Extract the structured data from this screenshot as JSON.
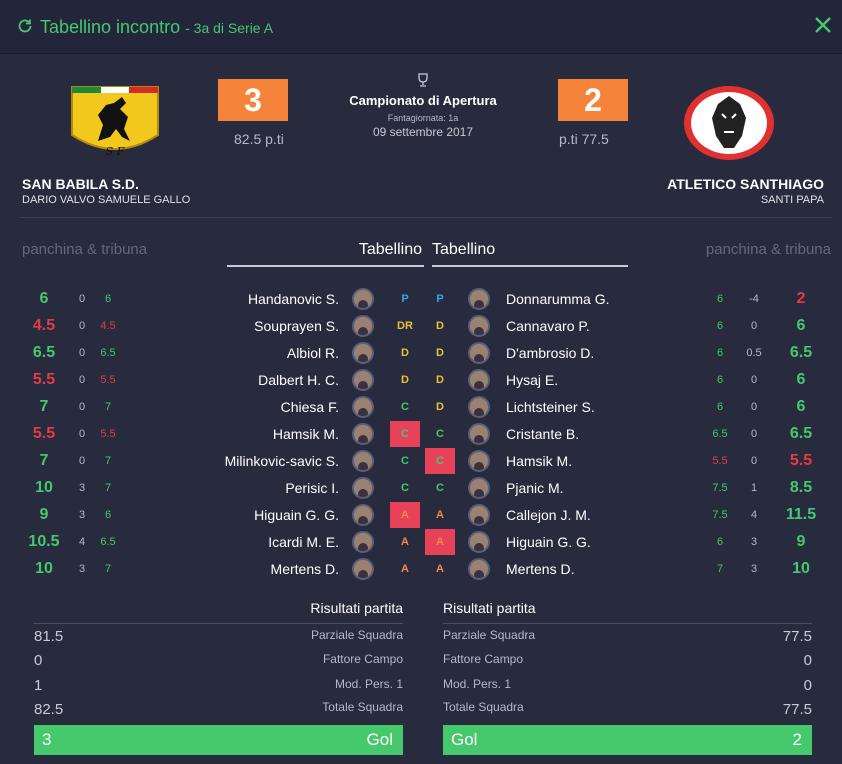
{
  "header": {
    "title": "Tabellino incontro",
    "subtitle": "- 3a di Serie A"
  },
  "match": {
    "competition": "Campionato di Apertura",
    "matchday": "Fantagiornata: 1a",
    "date": "09 settembre 2017",
    "home": {
      "name": "SAN BABILA S.D.",
      "coach": "DARIO VALVO SAMUELE GALLO",
      "score": "3",
      "points": "82.5 p.ti"
    },
    "away": {
      "name": "ATLETICO SANTHIAGO",
      "coach": "SANTI PAPA",
      "score": "2",
      "points": "p.ti 77.5"
    }
  },
  "labels": {
    "bench_left": "panchina & tribuna",
    "bench_right": "panchina & tribuna",
    "tab_left": "Tabellino",
    "tab_right": "Tabellino"
  },
  "home_players": [
    {
      "total": "6",
      "bonus": "0",
      "vote": "6",
      "name": "Handanovic S.",
      "role": "P",
      "total_color": "g",
      "vote_color": "g",
      "role_color": "rp",
      "highlight": false
    },
    {
      "total": "4.5",
      "bonus": "0",
      "vote": "4.5",
      "name": "Souprayen S.",
      "role": "DR",
      "total_color": "r",
      "vote_color": "r",
      "role_color": "rd",
      "highlight": false
    },
    {
      "total": "6.5",
      "bonus": "0",
      "vote": "6.5",
      "name": "Albiol R.",
      "role": "D",
      "total_color": "g",
      "vote_color": "g",
      "role_color": "rd",
      "highlight": false
    },
    {
      "total": "5.5",
      "bonus": "0",
      "vote": "5.5",
      "name": "Dalbert H. C.",
      "role": "D",
      "total_color": "r",
      "vote_color": "r",
      "role_color": "rd",
      "highlight": false
    },
    {
      "total": "7",
      "bonus": "0",
      "vote": "7",
      "name": "Chiesa F.",
      "role": "C",
      "total_color": "g",
      "vote_color": "g",
      "role_color": "rc",
      "highlight": false
    },
    {
      "total": "5.5",
      "bonus": "0",
      "vote": "5.5",
      "name": "Hamsik M.",
      "role": "C",
      "total_color": "r",
      "vote_color": "r",
      "role_color": "rc",
      "highlight": true
    },
    {
      "total": "7",
      "bonus": "0",
      "vote": "7",
      "name": "Milinkovic-savic S.",
      "role": "C",
      "total_color": "g",
      "vote_color": "g",
      "role_color": "rc",
      "highlight": false
    },
    {
      "total": "10",
      "bonus": "3",
      "vote": "7",
      "name": "Perisic I.",
      "role": "C",
      "total_color": "g",
      "vote_color": "g",
      "role_color": "rc",
      "highlight": false
    },
    {
      "total": "9",
      "bonus": "3",
      "vote": "6",
      "name": "Higuain G. G.",
      "role": "A",
      "total_color": "g",
      "vote_color": "g",
      "role_color": "ra",
      "highlight": true
    },
    {
      "total": "10.5",
      "bonus": "4",
      "vote": "6.5",
      "name": "Icardi M. E.",
      "role": "A",
      "total_color": "g",
      "vote_color": "g",
      "role_color": "ra",
      "highlight": false
    },
    {
      "total": "10",
      "bonus": "3",
      "vote": "7",
      "name": "Mertens D.",
      "role": "A",
      "total_color": "g",
      "vote_color": "g",
      "role_color": "ra",
      "highlight": false
    }
  ],
  "away_players": [
    {
      "total": "2",
      "bonus": "-4",
      "vote": "6",
      "name": "Donnarumma G.",
      "role": "P",
      "total_color": "r",
      "vote_color": "g",
      "role_color": "rp",
      "highlight": false
    },
    {
      "total": "6",
      "bonus": "0",
      "vote": "6",
      "name": "Cannavaro P.",
      "role": "D",
      "total_color": "g",
      "vote_color": "g",
      "role_color": "rd",
      "highlight": false
    },
    {
      "total": "6.5",
      "bonus": "0.5",
      "vote": "6",
      "name": "D'ambrosio D.",
      "role": "D",
      "total_color": "g",
      "vote_color": "g",
      "role_color": "rd",
      "highlight": false
    },
    {
      "total": "6",
      "bonus": "0",
      "vote": "6",
      "name": "Hysaj E.",
      "role": "D",
      "total_color": "g",
      "vote_color": "g",
      "role_color": "rd",
      "highlight": false
    },
    {
      "total": "6",
      "bonus": "0",
      "vote": "6",
      "name": "Lichtsteiner S.",
      "role": "D",
      "total_color": "g",
      "vote_color": "g",
      "role_color": "rd",
      "highlight": false
    },
    {
      "total": "6.5",
      "bonus": "0",
      "vote": "6.5",
      "name": "Cristante B.",
      "role": "C",
      "total_color": "g",
      "vote_color": "g",
      "role_color": "rc",
      "highlight": false
    },
    {
      "total": "5.5",
      "bonus": "0",
      "vote": "5.5",
      "name": "Hamsik M.",
      "role": "C",
      "total_color": "r",
      "vote_color": "r",
      "role_color": "rc",
      "highlight": true
    },
    {
      "total": "8.5",
      "bonus": "1",
      "vote": "7.5",
      "name": "Pjanic M.",
      "role": "C",
      "total_color": "g",
      "vote_color": "g",
      "role_color": "rc",
      "highlight": false
    },
    {
      "total": "11.5",
      "bonus": "4",
      "vote": "7.5",
      "name": "Callejon J. M.",
      "role": "A",
      "total_color": "g",
      "vote_color": "g",
      "role_color": "ra",
      "highlight": false
    },
    {
      "total": "9",
      "bonus": "3",
      "vote": "6",
      "name": "Higuain G. G.",
      "role": "A",
      "total_color": "g",
      "vote_color": "g",
      "role_color": "ra",
      "highlight": true
    },
    {
      "total": "10",
      "bonus": "3",
      "vote": "7",
      "name": "Mertens D.",
      "role": "A",
      "total_color": "g",
      "vote_color": "g",
      "role_color": "ra",
      "highlight": false
    }
  ],
  "results": {
    "title_left": "Risultati partita",
    "title_right": "Risultati partita",
    "labels": [
      "Parziale Squadra",
      "Fattore Campo",
      "Mod. Pers. 1",
      "Totale Squadra"
    ],
    "home_values": [
      "81.5",
      "0",
      "1",
      "82.5"
    ],
    "away_values": [
      "77.5",
      "0",
      "0",
      "77.5"
    ],
    "goals_label": "Gol",
    "home_goals": "3",
    "away_goals": "2"
  },
  "colors": {
    "accent": "#46c86c",
    "score_bg": "#f5843a",
    "highlight": "#e8425a",
    "background": "#282a3e"
  }
}
